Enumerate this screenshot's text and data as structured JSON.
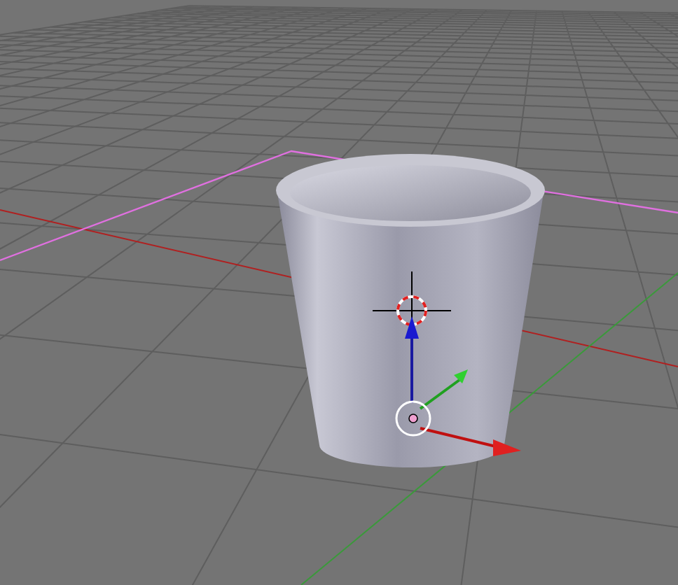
{
  "viewport": {
    "show_grid": true,
    "show_manipulator": true,
    "show_cursor": true
  }
}
